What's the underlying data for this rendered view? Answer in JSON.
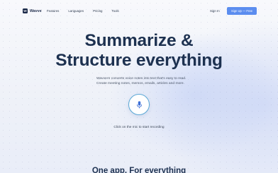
{
  "brand": {
    "name": "Wavve"
  },
  "nav": {
    "items": [
      "Features",
      "Languages",
      "Pricing",
      "Tools"
    ]
  },
  "auth": {
    "signin": "Sign In",
    "signup": "Sign Up — Free"
  },
  "hero": {
    "headline_line1": "Summarize &",
    "headline_line2": "Structure everything",
    "description": "WavveAI converts voice notes into text that's easy to read. Create meeting notes, memos, emails, articles and more.",
    "mic_caption": "Click on the mic to start recording"
  },
  "section": {
    "title": "One app. For everything"
  },
  "colors": {
    "accent": "#5b8def",
    "headline": "#1d3150",
    "mic_ring": "#5aa7d6"
  },
  "icons": {
    "logo": "wave-logo-icon",
    "mic": "microphone-icon"
  }
}
